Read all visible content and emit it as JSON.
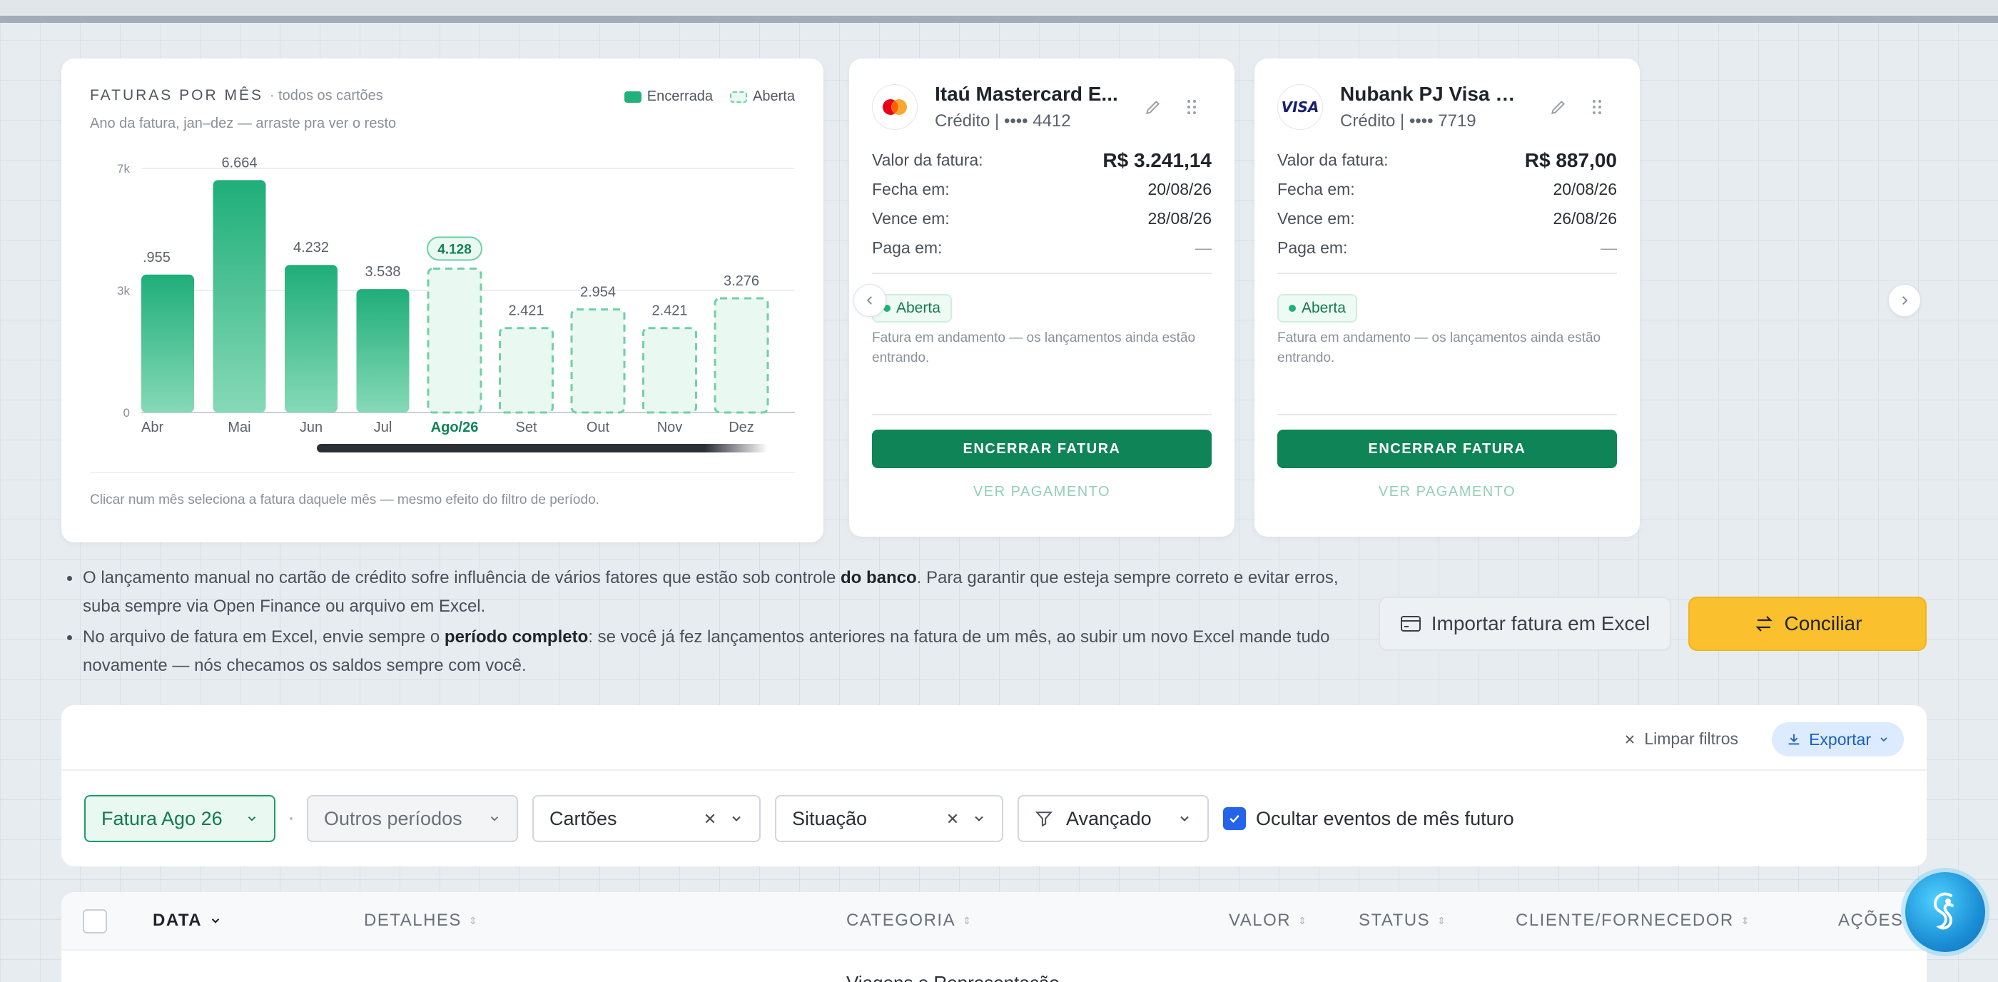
{
  "chart_section": {
    "title": "FATURAS POR MÊS",
    "title_suffix": "· todos os cartões",
    "subtitle": "Ano da fatura, jan–dez — arraste pra ver o resto",
    "legend_closed": "Encerrada",
    "legend_open": "Aberta",
    "footnote": "Clicar num mês seleciona a fatura daquele mês — mesmo efeito do filtro de período."
  },
  "chart_data": {
    "type": "bar",
    "title": "FATURAS POR MÊS",
    "categories": [
      "Abr",
      "Mai",
      "Jun",
      "Jul",
      "Ago/26",
      "Set",
      "Out",
      "Nov",
      "Dez"
    ],
    "values": [
      3955,
      6664,
      4232,
      3538,
      4128,
      2421,
      2954,
      2421,
      3276
    ],
    "value_labels": [
      ".955",
      "6.664",
      "4.232",
      "3.538",
      "4.128",
      "2.421",
      "2.954",
      "2.421",
      "3.276"
    ],
    "status": [
      "Encerrada",
      "Encerrada",
      "Encerrada",
      "Encerrada",
      "Aberta",
      "Aberta",
      "Aberta",
      "Aberta",
      "Aberta"
    ],
    "selected_index": 4,
    "y_ticks": [
      0,
      3500,
      7000
    ],
    "y_tick_labels": [
      "0",
      "3k",
      "7k"
    ],
    "ylim": [
      0,
      7000
    ],
    "grid": true,
    "legend": "top-right",
    "colors": {
      "closed": "#22b07d",
      "open_fill": "#eaf8f2",
      "open_stroke": "#6fd0a8",
      "selected": "#0f8456"
    }
  },
  "cards": [
    {
      "name": "Itaú Mastercard E...",
      "sub": "Crédito | •••• 4412",
      "brand": "mastercard-logo",
      "rows": [
        {
          "label": "Valor da fatura:",
          "value": "R$ 3.241,14"
        },
        {
          "label": "Fecha em:",
          "value": "20/08/26"
        },
        {
          "label": "Vence em:",
          "value": "28/08/26"
        },
        {
          "label": "Paga em:",
          "value": "—"
        }
      ],
      "status": "Aberta",
      "description": "Fatura em andamento — os lançamentos ainda estão entrando.",
      "close_button": "ENCERRAR FATURA",
      "payment_link": "VER PAGAMENTO"
    },
    {
      "name": "Nubank PJ Visa — ...",
      "sub": "Crédito | •••• 7719",
      "brand": "visa-logo",
      "brand_text": "VISA",
      "rows": [
        {
          "label": "Valor da fatura:",
          "value": "R$ 887,00"
        },
        {
          "label": "Fecha em:",
          "value": "20/08/26"
        },
        {
          "label": "Vence em:",
          "value": "26/08/26"
        },
        {
          "label": "Paga em:",
          "value": "—"
        }
      ],
      "status": "Aberta",
      "description": "Fatura em andamento — os lançamentos ainda estão entrando.",
      "close_button": "ENCERRAR FATURA",
      "payment_link": "VER PAGAMENTO"
    }
  ],
  "notes": {
    "n1_a": "O lançamento manual no cartão de crédito sofre influência de vários fatores que estão sob controle ",
    "n1_b": "do banco",
    "n1_c": ". Para garantir que esteja sempre correto e evitar erros, suba sempre via Open Finance ou arquivo em Excel.",
    "n2_a": "No arquivo de fatura em Excel, envie sempre o ",
    "n2_b": "período completo",
    "n2_c": ": se você já fez lançamentos anteriores na fatura de um mês, ao subir um novo Excel mande tudo novamente — nós checamos os saldos sempre com você."
  },
  "actions": {
    "import_excel": "Importar fatura em Excel",
    "reconcile": "Conciliar"
  },
  "filters": {
    "clear": "Limpar filtros",
    "export": "Exportar",
    "invoice": "Fatura Ago 26",
    "other_periods": "Outros períodos",
    "cards": "Cartões",
    "status": "Situação",
    "advanced": "Avançado",
    "hide_future": "Ocultar eventos de mês futuro",
    "hide_future_checked": true
  },
  "table": {
    "headers": [
      "DATA",
      "DETALHES",
      "CATEGORIA",
      "VALOR",
      "STATUS",
      "CLIENTE/FORNECEDOR",
      "AÇÕES"
    ],
    "peek_category": "Viagens e Representação"
  },
  "colors": {
    "accent_green": "#0f8456",
    "brand_yellow": "#fbc02d",
    "link_blue": "#1b5fbf",
    "checkbox_blue": "#2563eb"
  }
}
